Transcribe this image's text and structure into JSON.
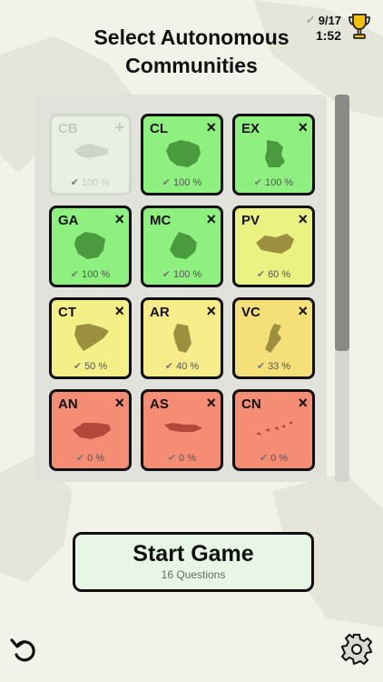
{
  "header": {
    "title": "Select Autonomous Communities",
    "progress": "9/17",
    "timer": "1:52"
  },
  "colors": {
    "green": "#8ef07f",
    "yellow": "#f4f088",
    "lightyellow": "#f7eb8a",
    "orangeyellow": "#f5df78",
    "red": "#f58c74",
    "disabled": "#e9f0e2"
  },
  "tiles": [
    {
      "code": "CB",
      "percent": "100 %",
      "state": "disabled",
      "toggle": "+",
      "color": "#e9f0e2",
      "icon": "cantabria-shape-icon"
    },
    {
      "code": "CL",
      "percent": "100 %",
      "state": "selected",
      "toggle": "×",
      "color": "#8ef07f",
      "icon": "castilla-leon-shape-icon"
    },
    {
      "code": "EX",
      "percent": "100 %",
      "state": "selected",
      "toggle": "×",
      "color": "#8ef07f",
      "icon": "extremadura-shape-icon"
    },
    {
      "code": "GA",
      "percent": "100 %",
      "state": "selected",
      "toggle": "×",
      "color": "#8ef07f",
      "icon": "galicia-shape-icon"
    },
    {
      "code": "MC",
      "percent": "100 %",
      "state": "selected",
      "toggle": "×",
      "color": "#8ef07f",
      "icon": "murcia-shape-icon"
    },
    {
      "code": "PV",
      "percent": "60 %",
      "state": "selected",
      "toggle": "×",
      "color": "#eaf282",
      "icon": "pais-vasco-shape-icon"
    },
    {
      "code": "CT",
      "percent": "50 %",
      "state": "selected",
      "toggle": "×",
      "color": "#f4f088",
      "icon": "catalonia-shape-icon"
    },
    {
      "code": "AR",
      "percent": "40 %",
      "state": "selected",
      "toggle": "×",
      "color": "#f7eb8a",
      "icon": "aragon-shape-icon"
    },
    {
      "code": "VC",
      "percent": "33 %",
      "state": "selected",
      "toggle": "×",
      "color": "#f5df78",
      "icon": "valencia-shape-icon"
    },
    {
      "code": "AN",
      "percent": "0 %",
      "state": "selected",
      "toggle": "×",
      "color": "#f58c74",
      "icon": "andalusia-shape-icon"
    },
    {
      "code": "AS",
      "percent": "0 %",
      "state": "selected",
      "toggle": "×",
      "color": "#f58c74",
      "icon": "asturias-shape-icon"
    },
    {
      "code": "CN",
      "percent": "0 %",
      "state": "selected",
      "toggle": "×",
      "color": "#f58c74",
      "icon": "canary-islands-shape-icon"
    }
  ],
  "start_button": {
    "label": "Start Game",
    "sub": "16 Questions"
  },
  "icons": {
    "trophy": "trophy-icon",
    "undo": "undo-icon",
    "settings": "gear-icon"
  }
}
